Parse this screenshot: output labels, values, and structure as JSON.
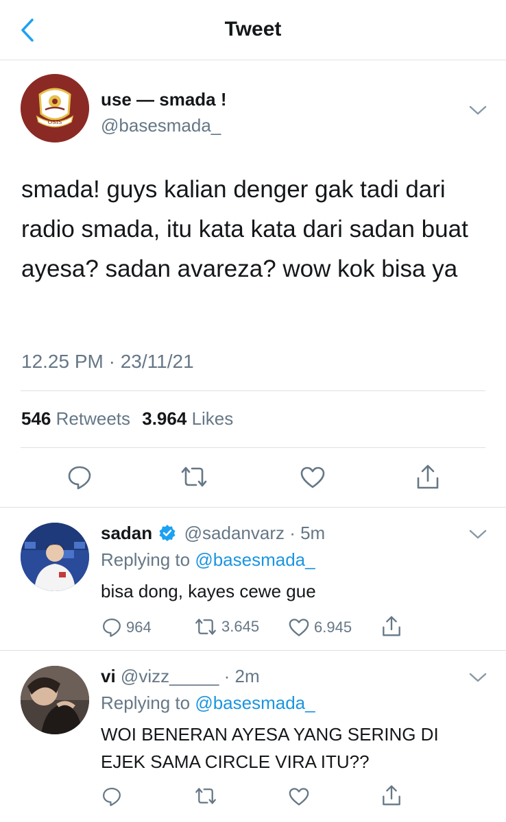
{
  "header": {
    "title": "Tweet"
  },
  "tweet": {
    "author_name": "use — smada !",
    "author_handle": "@basesmada_",
    "avatar_text": "OSIS",
    "text": "smada! guys kalian denger gak tadi dari radio smada, itu kata kata dari sadan buat ayesa? sadan avareza? wow kok bisa ya",
    "timestamp": "12.25 PM · 23/11/21",
    "retweets_count": "546",
    "retweets_label": "Retweets",
    "likes_count": "3.964",
    "likes_label": "Likes"
  },
  "replies": [
    {
      "name": "sadan",
      "verified": true,
      "handle": "@sadanvarz",
      "time": "· 5m",
      "replying_prefix": "Replying to",
      "replying_to": "@basesmada_",
      "text": "bisa dong, kayes cewe gue",
      "reply_count": "964",
      "retweet_count": "3.645",
      "like_count": "6.945"
    },
    {
      "name": "vi",
      "verified": false,
      "handle": "@vizz_____",
      "time": "· 2m",
      "replying_prefix": "Replying to",
      "replying_to": "@basesmada_",
      "text": "WOI BENERAN AYESA YANG SERING DI EJEK SAMA CIRCLE VIRA ITU??",
      "reply_count": "",
      "retweet_count": "",
      "like_count": ""
    }
  ],
  "colors": {
    "accent": "#1da1f2",
    "link": "#1b95e0",
    "secondary": "#657786",
    "avatar_bg": "#8b2a24"
  },
  "icons": [
    "back-chevron",
    "caret-down",
    "reply",
    "retweet",
    "like",
    "share",
    "verified-badge"
  ]
}
